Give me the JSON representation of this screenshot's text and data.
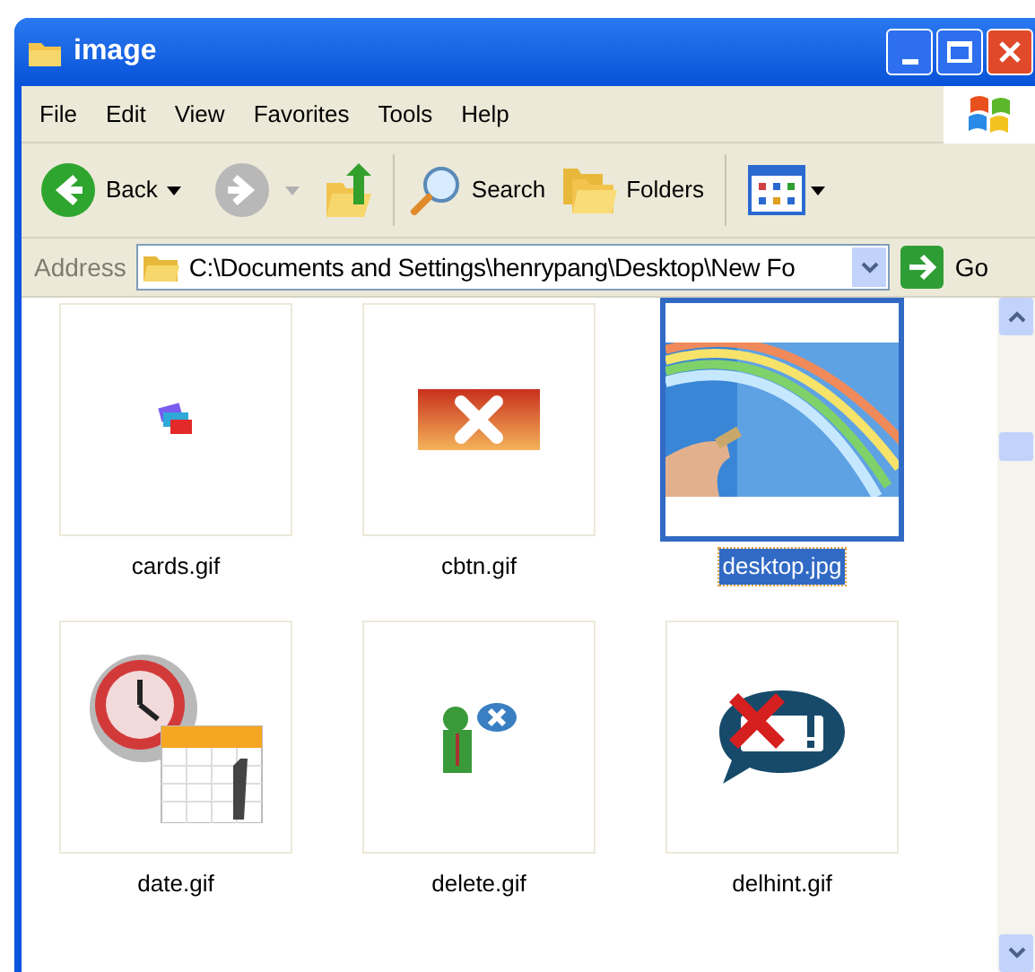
{
  "window": {
    "title": "image"
  },
  "menu": [
    {
      "label": "File"
    },
    {
      "label": "Edit"
    },
    {
      "label": "View"
    },
    {
      "label": "Favorites"
    },
    {
      "label": "Tools"
    },
    {
      "label": "Help"
    }
  ],
  "toolbar": {
    "back": "Back",
    "search": "Search",
    "folders": "Folders"
  },
  "address": {
    "label": "Address",
    "value": "C:\\Documents and Settings\\henrypang\\Desktop\\New Fo",
    "go": "Go"
  },
  "files": [
    {
      "name": "cards.gif",
      "kind": "cards",
      "selected": false
    },
    {
      "name": "cbtn.gif",
      "kind": "cancel",
      "selected": false
    },
    {
      "name": "desktop.jpg",
      "kind": "picture",
      "selected": true
    },
    {
      "name": "date.gif",
      "kind": "clock-calendar",
      "selected": false
    },
    {
      "name": "delete.gif",
      "kind": "user-delete",
      "selected": false
    },
    {
      "name": "delhint.gif",
      "kind": "message-delete",
      "selected": false
    }
  ]
}
